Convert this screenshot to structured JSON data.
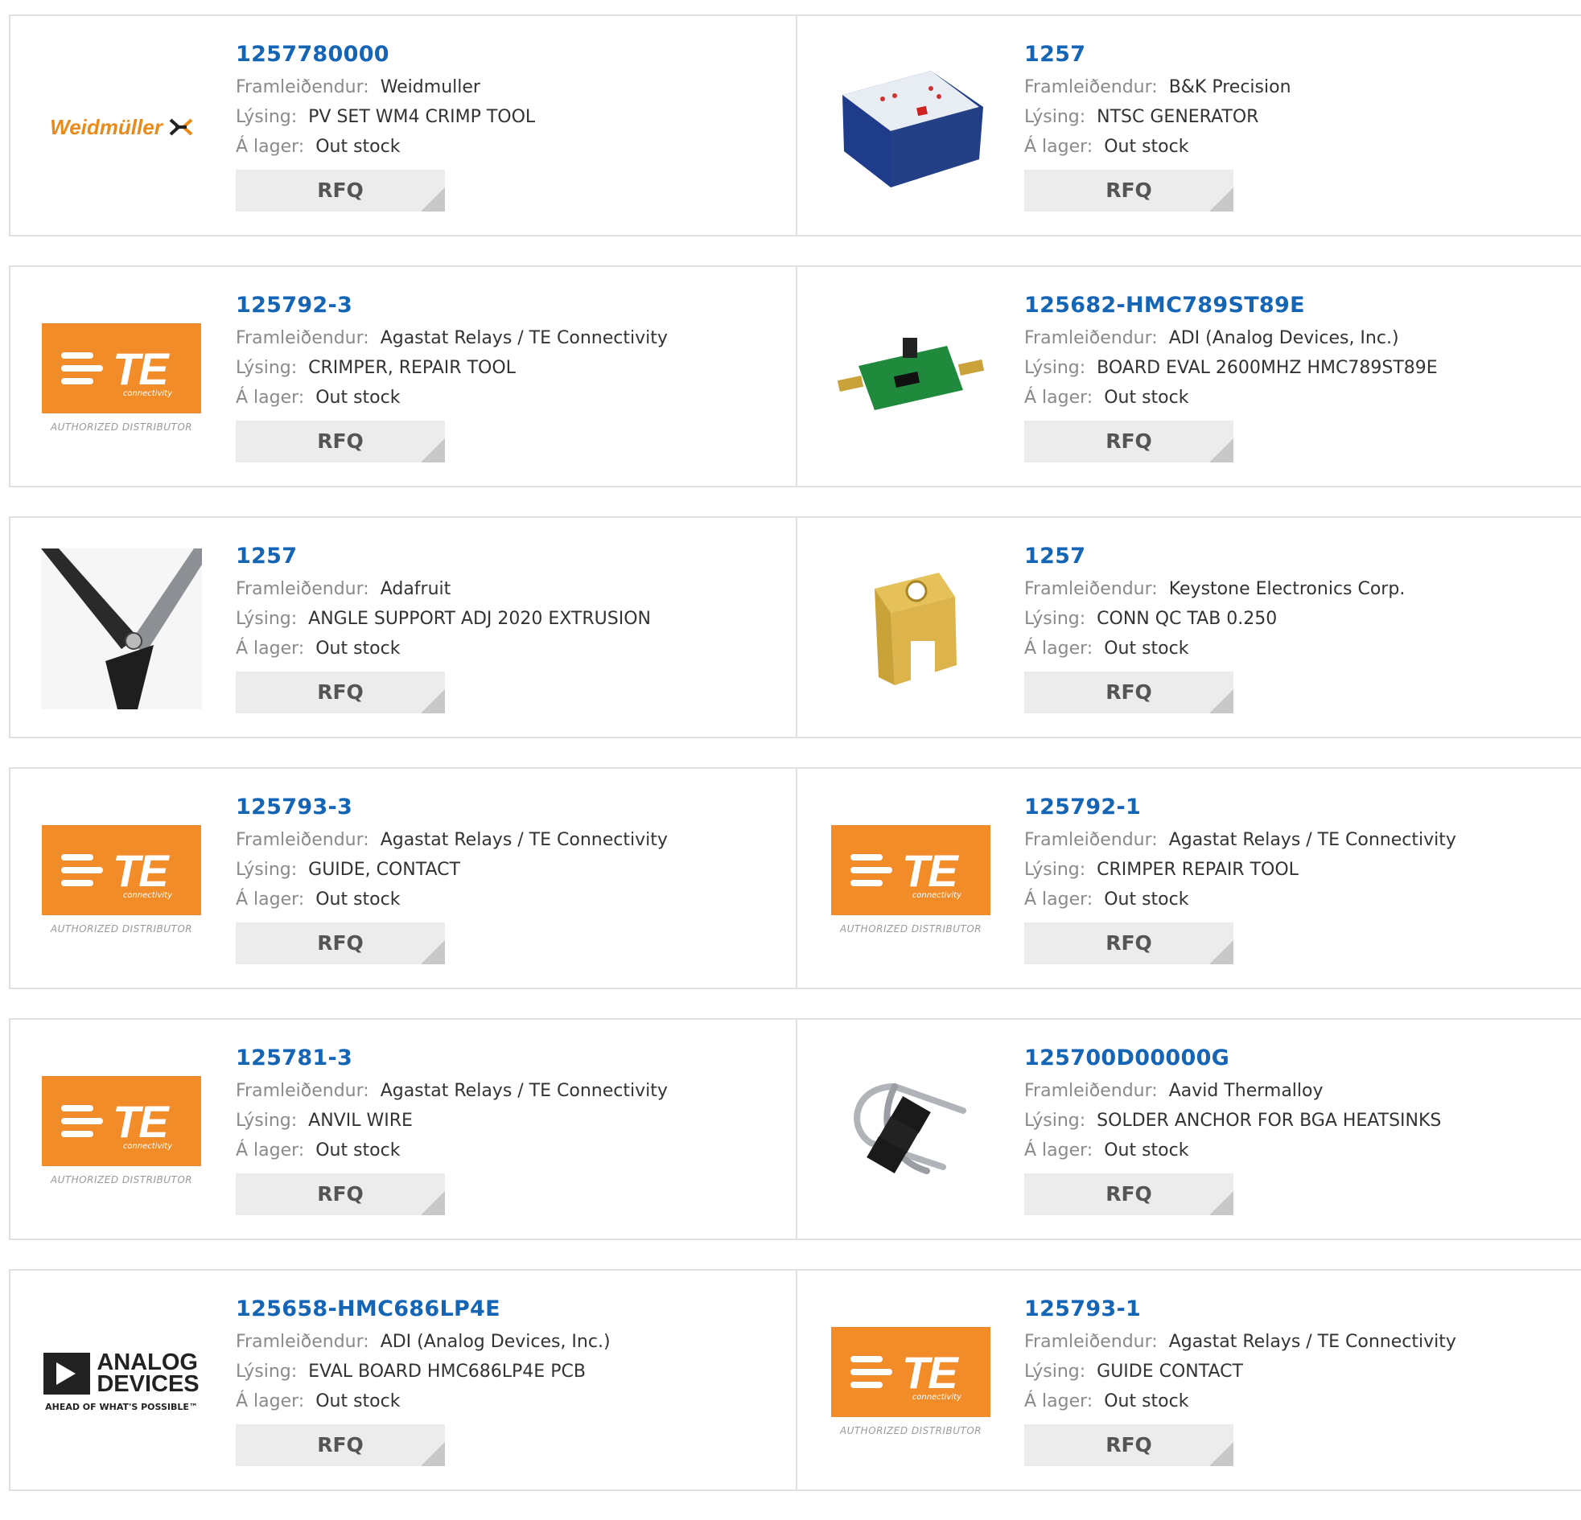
{
  "labels": {
    "manufacturer": "Framleiðendur:",
    "description": "Lýsing:",
    "stock": "Á lager:",
    "rfq": "RFQ"
  },
  "colors": {
    "part_link": "#1565b7",
    "te_orange": "#f28c28",
    "weidmuller_orange": "#e98a1b"
  },
  "logos": {
    "weidmuller": "Weidmüller",
    "te_letters": "TE",
    "te_connectivity": "connectivity",
    "te_authorized": "AUTHORIZED DISTRIBUTOR",
    "adi_line1": "ANALOG",
    "adi_line2": "DEVICES",
    "adi_tagline": "AHEAD OF WHAT'S POSSIBLE™"
  },
  "products": [
    {
      "part": "1257780000",
      "manufacturer": "Weidmuller",
      "description": "PV SET WM4 CRIMP TOOL",
      "stock": "Out stock",
      "image": "weidmuller-logo"
    },
    {
      "part": "1257",
      "manufacturer": "B&K Precision",
      "description": "NTSC GENERATOR",
      "stock": "Out stock",
      "image": "ntsc-generator-photo"
    },
    {
      "part": "125792-3",
      "manufacturer": "Agastat Relays / TE Connectivity",
      "description": "CRIMPER, REPAIR TOOL",
      "stock": "Out stock",
      "image": "te-logo"
    },
    {
      "part": "125682-HMC789ST89E",
      "manufacturer": "ADI (Analog Devices, Inc.)",
      "description": "BOARD EVAL 2600MHZ HMC789ST89E",
      "stock": "Out stock",
      "image": "eval-board-photo"
    },
    {
      "part": "1257",
      "manufacturer": "Adafruit",
      "description": "ANGLE SUPPORT ADJ 2020 EXTRUSION",
      "stock": "Out stock",
      "image": "angle-support-photo"
    },
    {
      "part": "1257",
      "manufacturer": "Keystone Electronics Corp.",
      "description": "CONN QC TAB 0.250",
      "stock": "Out stock",
      "image": "qc-tab-photo"
    },
    {
      "part": "125793-3",
      "manufacturer": "Agastat Relays / TE Connectivity",
      "description": "GUIDE, CONTACT",
      "stock": "Out stock",
      "image": "te-logo"
    },
    {
      "part": "125792-1",
      "manufacturer": "Agastat Relays / TE Connectivity",
      "description": "CRIMPER REPAIR TOOL",
      "stock": "Out stock",
      "image": "te-logo"
    },
    {
      "part": "125781-3",
      "manufacturer": "Agastat Relays / TE Connectivity",
      "description": "ANVIL WIRE",
      "stock": "Out stock",
      "image": "te-logo"
    },
    {
      "part": "125700D00000G",
      "manufacturer": "Aavid Thermalloy",
      "description": "SOLDER ANCHOR FOR BGA HEATSINKS",
      "stock": "Out stock",
      "image": "solder-anchor-photo"
    },
    {
      "part": "125658-HMC686LP4E",
      "manufacturer": "ADI (Analog Devices, Inc.)",
      "description": "EVAL BOARD HMC686LP4E PCB",
      "stock": "Out stock",
      "image": "adi-logo"
    },
    {
      "part": "125793-1",
      "manufacturer": "Agastat Relays / TE Connectivity",
      "description": "GUIDE CONTACT",
      "stock": "Out stock",
      "image": "te-logo"
    }
  ]
}
